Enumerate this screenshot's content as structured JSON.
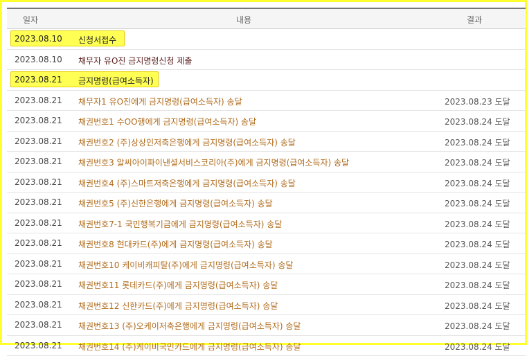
{
  "headers": {
    "date": "일자",
    "content": "내용",
    "result": "결과"
  },
  "rows": [
    {
      "date": "2023.08.10",
      "content": "신청서접수",
      "result": "",
      "highlight": true
    },
    {
      "date": "2023.08.10",
      "content": "채무자 유O진 금지명령신청 제출",
      "result": "",
      "dark": true
    },
    {
      "date": "2023.08.21",
      "content": "금지명령(급여소득자)",
      "result": "",
      "highlight": true
    },
    {
      "date": "2023.08.21",
      "content": "채무자1 유O진에게 금지명령(급여소득자) 송달",
      "result": "2023.08.23 도달"
    },
    {
      "date": "2023.08.21",
      "content": "채권번호1 수OO행에게 금지명령(급여소득자) 송달",
      "result": "2023.08.24 도달"
    },
    {
      "date": "2023.08.21",
      "content": "채권번호2 (주)상상인저축은행에게 금지명령(급여소득자) 송달",
      "result": "2023.08.24 도달"
    },
    {
      "date": "2023.08.21",
      "content": "채권번호3 알씨아이파이낸셜서비스코리아(주)에게 금지명령(급여소득자) 송달",
      "result": "2023.08.24 도달"
    },
    {
      "date": "2023.08.21",
      "content": "채권번호4 (주)스마트저축은행에게 금지명령(급여소득자) 송달",
      "result": "2023.08.24 도달"
    },
    {
      "date": "2023.08.21",
      "content": "채권번호5 (주)신한은행에게 금지명령(급여소득자) 송달",
      "result": "2023.08.24 도달"
    },
    {
      "date": "2023.08.21",
      "content": "채권번호7-1 국민행복기금에게 금지명령(급여소득자) 송달",
      "result": "2023.08.24 도달"
    },
    {
      "date": "2023.08.21",
      "content": "채권번호8 현대카드(주)에게 금지명령(급여소득자) 송달",
      "result": "2023.08.24 도달"
    },
    {
      "date": "2023.08.21",
      "content": "채권번호10 케이비캐피탈(주)에게 금지명령(급여소득자) 송달",
      "result": "2023.08.24 도달"
    },
    {
      "date": "2023.08.21",
      "content": "채권번호11 롯데카드(주)에게 금지명령(급여소득자) 송달",
      "result": "2023.08.24 도달"
    },
    {
      "date": "2023.08.21",
      "content": "채권번호12 신한카드(주)에게 금지명령(급여소득자) 송달",
      "result": "2023.08.24 도달"
    },
    {
      "date": "2023.08.21",
      "content": "채권번호13 (주)오케이저축은행에게 금지명령(급여소득자) 송달",
      "result": "2023.08.24 도달"
    },
    {
      "date": "2023.08.21",
      "content": "채권번호14 (주)케이비국민카드에게 금지명령(급여소득자) 송달",
      "result": "2023.08.24 도달"
    }
  ]
}
